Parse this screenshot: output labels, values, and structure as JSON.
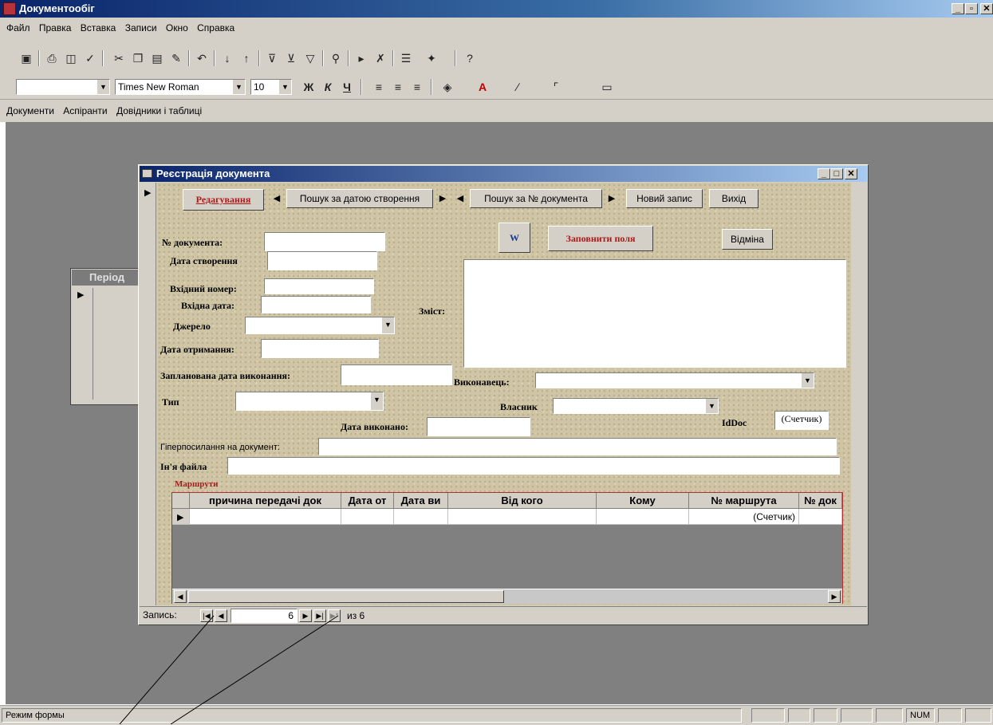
{
  "app": {
    "title": "Документообіг"
  },
  "menu": [
    "Файл",
    "Правка",
    "Вставка",
    "Записи",
    "Окно",
    "Справка"
  ],
  "toolbar_fmt": {
    "font": "Times New Roman",
    "size": "10",
    "bold": "Ж",
    "italic": "К",
    "underline": "Ч"
  },
  "custom_menu": [
    "Документи",
    "Аспіранти",
    "Довідники і таблиці"
  ],
  "bg_form": {
    "title": "Період"
  },
  "form": {
    "title": "Реєстрація документа",
    "buttons": {
      "edit": "Редагування",
      "search_date": "Пошук за датою створення",
      "search_num": "Пошук за № документа",
      "new_record": "Новий запис",
      "exit": "Вихід",
      "word": "W",
      "fill": "Заповнити поля",
      "cancel": "Відміна"
    },
    "labels": {
      "doc_number": "№ документа:",
      "created": "Дата створення",
      "incoming_num": "Вхідний номер:",
      "incoming_date": "Вхідна дата:",
      "source": "Джерело",
      "received": "Дата отримання:",
      "planned": "Запланована дата виконання:",
      "type": "Тип",
      "done": "Дата виконано:",
      "content": "Зміст:",
      "executor": "Виконавець:",
      "owner": "Власник",
      "iddoc": "IdDoc",
      "hyperlink": "Гіперпосилання на документ:",
      "filename": "Ін'я файла"
    },
    "iddoc_value": "(Счетчик)",
    "subform": {
      "title": "Маршрути",
      "columns": [
        "причина передачі док",
        "Дата от",
        "Дата ви",
        "Від кого",
        "Кому",
        "№ маршрута",
        "№ док"
      ],
      "new_row": [
        "",
        "",
        "",
        "",
        "",
        "(Счетчик)",
        ""
      ]
    }
  },
  "record_nav": {
    "label": "Запись:",
    "current": "6",
    "of": "из 6"
  },
  "status": {
    "mode": "Режим формы",
    "num": "NUM"
  }
}
